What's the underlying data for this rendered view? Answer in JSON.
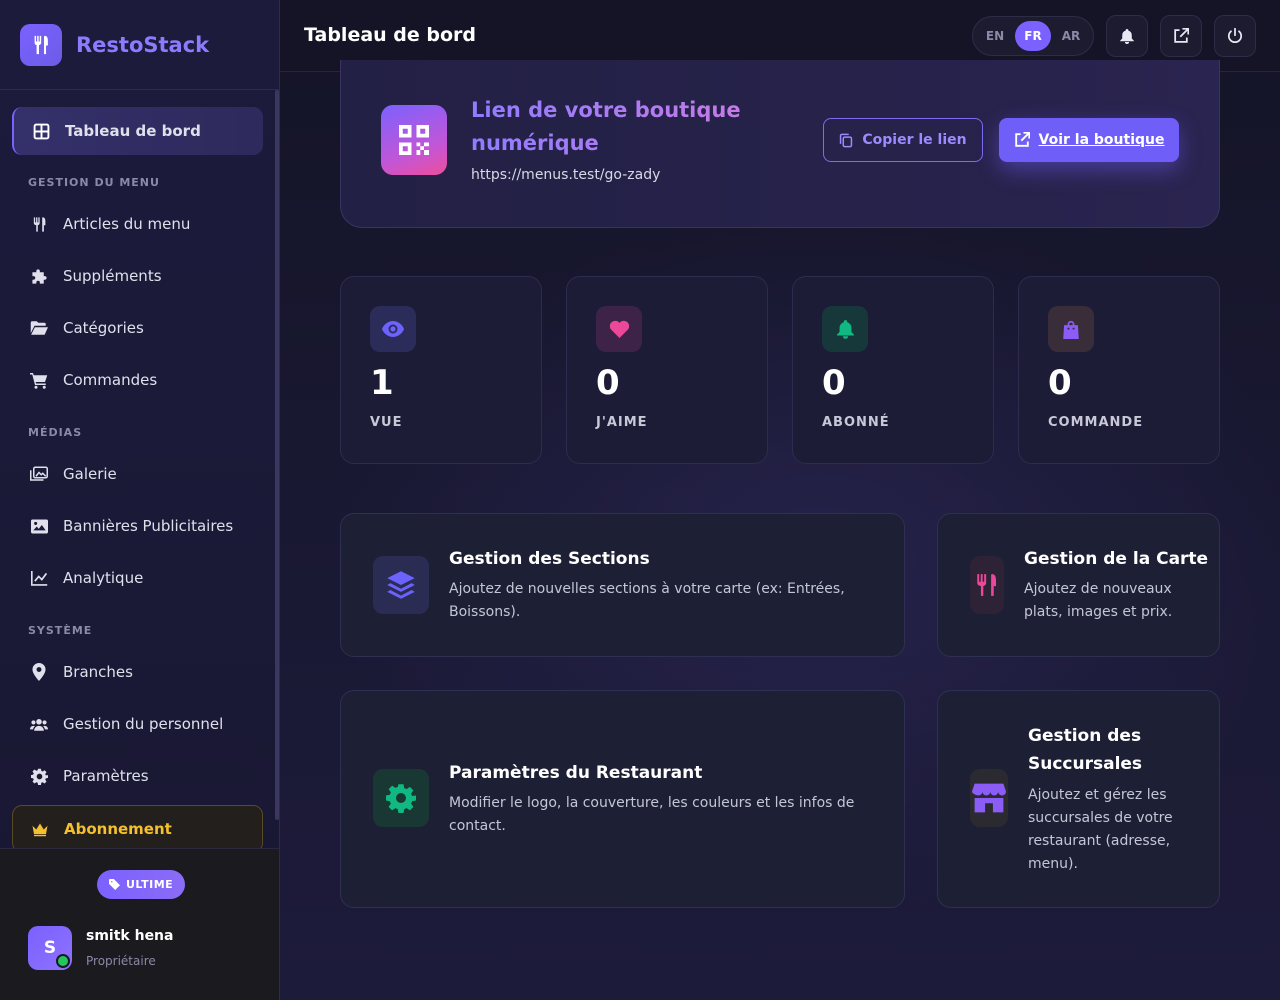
{
  "brand": {
    "name": "RestoStack"
  },
  "sidebar": {
    "active": {
      "label": "Tableau de bord"
    },
    "sections": {
      "menu": "GESTION DU MENU",
      "media": "MÉDIAS",
      "system": "SYSTÈME"
    },
    "items": {
      "menu_items": "Articles du menu",
      "supplements": "Suppléments",
      "categories": "Catégories",
      "orders": "Commandes",
      "gallery": "Galerie",
      "banners": "Bannières Publicitaires",
      "analytics": "Analytique",
      "branches": "Branches",
      "staff": "Gestion du personnel",
      "settings": "Paramètres",
      "subscription": "Abonnement"
    },
    "plan": "ULTIME",
    "user": {
      "initial": "S",
      "name": "smitk hena",
      "role": "Propriétaire"
    }
  },
  "header": {
    "title": "Tableau de bord",
    "languages": [
      "EN",
      "FR",
      "AR"
    ],
    "active_language": "FR"
  },
  "shop": {
    "title": "Lien de votre boutique numérique",
    "url": "https://menus.test/go-zady",
    "copy_label": "Copier le lien",
    "view_label": "Voir la boutique"
  },
  "stats": [
    {
      "value": "1",
      "label": "VUE",
      "icon": "eye-icon",
      "color": "#6c63ff"
    },
    {
      "value": "0",
      "label": "J'AIME",
      "icon": "heart-icon",
      "color": "#ec4899"
    },
    {
      "value": "0",
      "label": "ABONNÉ",
      "icon": "bell-icon",
      "color": "#10b981"
    },
    {
      "value": "0",
      "label": "COMMANDE",
      "icon": "shopping-bag-icon",
      "color": "#8b5cf6"
    }
  ],
  "actions": {
    "sections": {
      "title": "Gestion des Sections",
      "desc": "Ajoutez de nouvelles sections à votre carte (ex: Entrées, Boissons)."
    },
    "menu": {
      "title": "Gestion de la Carte",
      "desc": "Ajoutez de nouveaux plats, images et prix."
    },
    "restaurant": {
      "title": "Paramètres du Restaurant",
      "desc": "Modifier le logo, la couverture, les couleurs et les infos de contact."
    },
    "branches": {
      "title": "Gestion des Succursales",
      "desc": "Ajoutez et gérez les succursales de votre restaurant (adresse, menu)."
    }
  },
  "colors": {
    "accent": "#7b61ff",
    "gold": "#f5c02e",
    "online": "#22c55e"
  }
}
